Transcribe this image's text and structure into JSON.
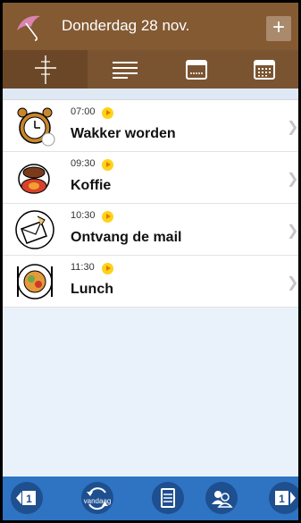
{
  "header": {
    "title": "Donderdag 28 nov.",
    "add_label": "+",
    "brand_color": "#845a33"
  },
  "tabs": [
    {
      "name": "timeline",
      "icon": "timeline-icon",
      "active": true
    },
    {
      "name": "list",
      "icon": "list-icon",
      "active": false
    },
    {
      "name": "week",
      "icon": "week-calendar-icon",
      "active": false
    },
    {
      "name": "month",
      "icon": "month-calendar-icon",
      "active": false
    }
  ],
  "events": [
    {
      "time": "07:00",
      "label": "Wakker worden",
      "icon": "alarm-clock-icon"
    },
    {
      "time": "09:30",
      "label": "Koffie",
      "icon": "coffee-cup-icon"
    },
    {
      "time": "10:30",
      "label": "Ontvang de mail",
      "icon": "mail-icon"
    },
    {
      "time": "11:30",
      "label": "Lunch",
      "icon": "lunch-plate-icon"
    }
  ],
  "footer": {
    "prev_day": "1",
    "today_label": "vandaag",
    "next_day": "1",
    "accent": "#2f73c3"
  }
}
